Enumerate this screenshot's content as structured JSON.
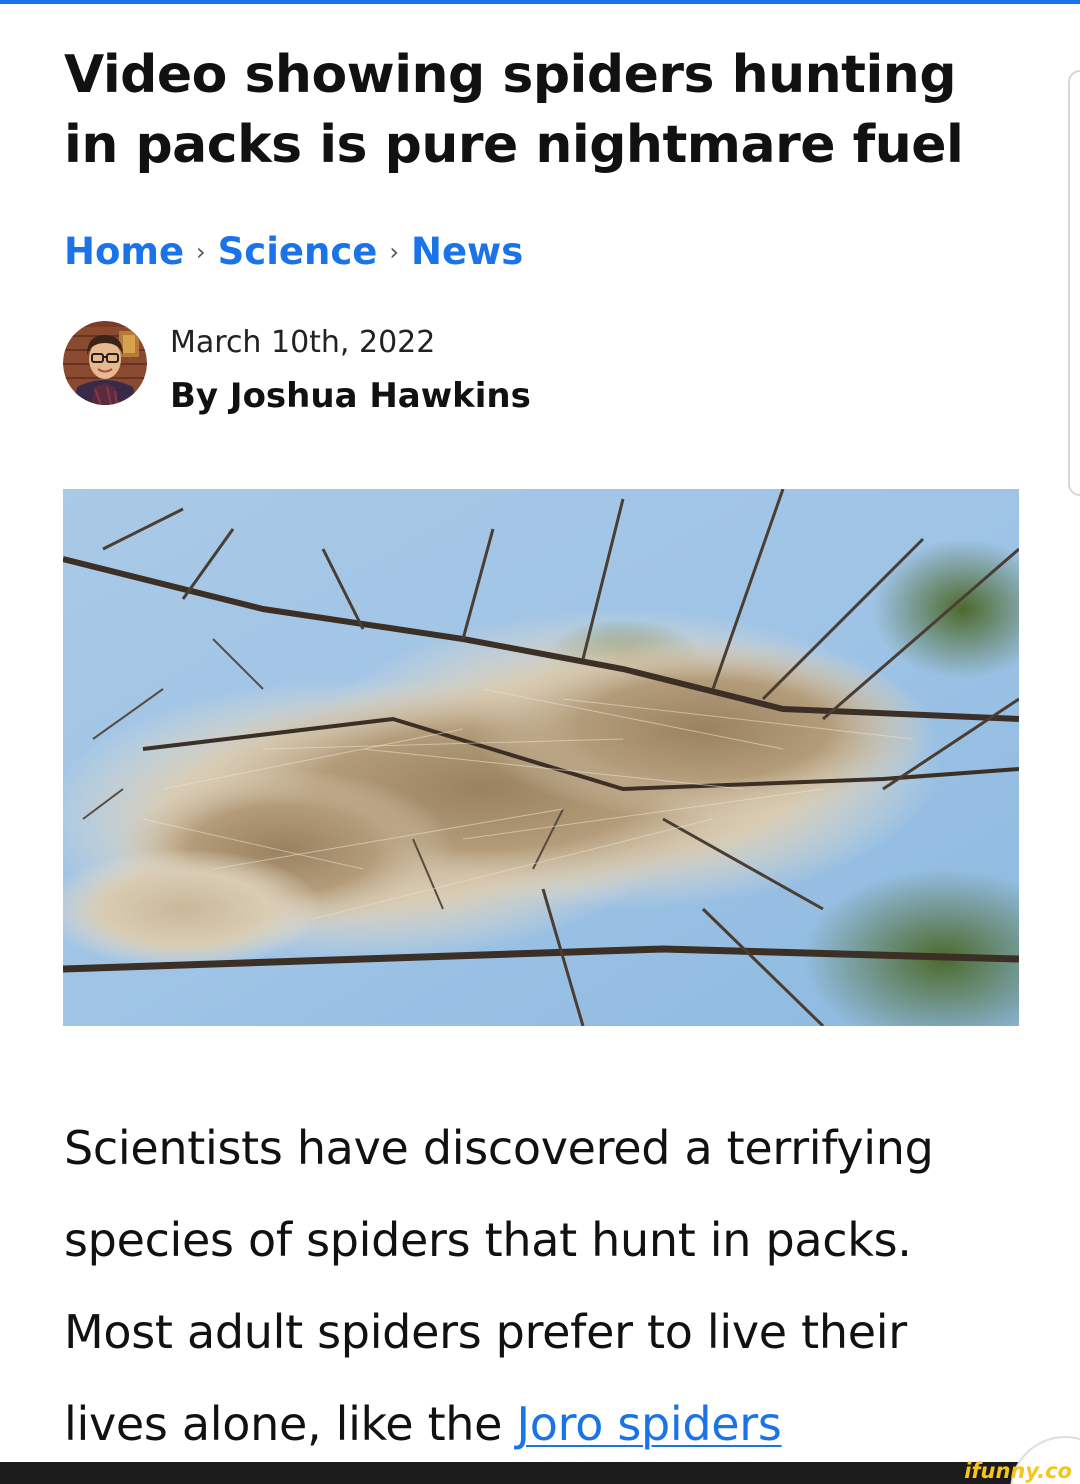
{
  "article": {
    "headline": "Video showing spiders hunting in packs is pure nightmare fuel",
    "breadcrumb": [
      {
        "label": "Home"
      },
      {
        "label": "Science"
      },
      {
        "label": "News"
      }
    ],
    "breadcrumb_separator": "›",
    "date": "March 10th, 2022",
    "author": "By Joshua Hawkins",
    "body_text": "Scientists have discovered a terrifying species of spiders that hunt in packs. Most adult spiders prefer to live their lives alone, like the ",
    "body_link": "Joro spiders"
  },
  "watermark": "ifunny.co",
  "icons": {
    "author_avatar": "author-avatar-photo",
    "hero_image": "spider-web-nest-in-tree-photo"
  },
  "colors": {
    "link": "#1a73e8",
    "text": "#111111",
    "watermark": "#f5c518",
    "bottom_bar": "#1b1b1b"
  }
}
